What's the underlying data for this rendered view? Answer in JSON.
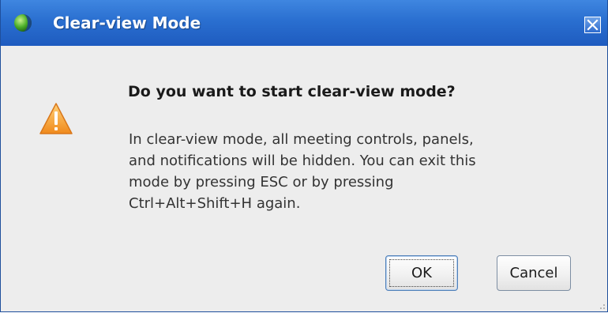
{
  "window": {
    "title": "Clear-view Mode",
    "close_symbol": "✕"
  },
  "dialog": {
    "heading": "Do you want to start clear-view mode?",
    "message_lines": [
      "In clear-view mode, all meeting controls, panels,",
      "and notifications will be hidden. You can exit this",
      "mode by pressing ESC or by pressing",
      "Ctrl+Alt+Shift+H again."
    ],
    "icon": "warning-icon"
  },
  "buttons": {
    "ok_label": "OK",
    "cancel_label": "Cancel"
  },
  "colors": {
    "titlebar": "#2a6fd0",
    "dialog_background": "#ededed",
    "warning": "#f5a623"
  }
}
